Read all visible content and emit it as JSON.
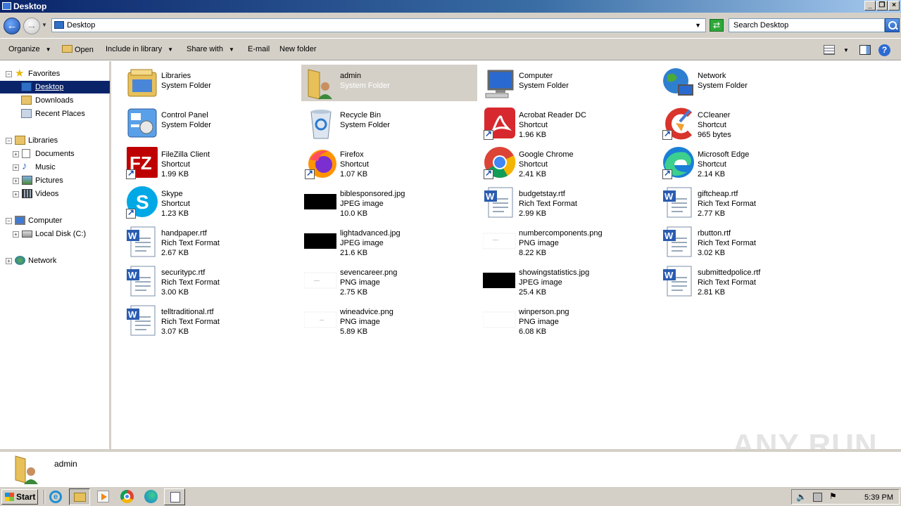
{
  "window": {
    "title": "Desktop"
  },
  "address": {
    "path": "Desktop",
    "search_placeholder": "Search Desktop"
  },
  "toolbar": {
    "organize": "Organize",
    "open": "Open",
    "include": "Include in library",
    "share": "Share with",
    "email": "E-mail",
    "new_folder": "New folder"
  },
  "nav": {
    "favorites": "Favorites",
    "desktop": "Desktop",
    "downloads": "Downloads",
    "recent": "Recent Places",
    "libraries": "Libraries",
    "documents": "Documents",
    "music": "Music",
    "pictures": "Pictures",
    "videos": "Videos",
    "computer": "Computer",
    "localdisk": "Local Disk (C:)",
    "network": "Network"
  },
  "items": [
    {
      "name": "Libraries",
      "type": "System Folder",
      "size": "",
      "icon": "libraries-icon"
    },
    {
      "name": "admin",
      "type": "System Folder",
      "size": "",
      "icon": "user-folder-icon"
    },
    {
      "name": "Computer",
      "type": "System Folder",
      "size": "",
      "icon": "computer-icon"
    },
    {
      "name": "Network",
      "type": "System Folder",
      "size": "",
      "icon": "network-icon"
    },
    {
      "name": "Control Panel",
      "type": "System Folder",
      "size": "",
      "icon": "control-panel-icon"
    },
    {
      "name": "Recycle Bin",
      "type": "System Folder",
      "size": "",
      "icon": "recycle-bin-icon"
    },
    {
      "name": "Acrobat Reader DC",
      "type": "Shortcut",
      "size": "1.96 KB",
      "icon": "acrobat-icon"
    },
    {
      "name": "CCleaner",
      "type": "Shortcut",
      "size": "965 bytes",
      "icon": "ccleaner-icon"
    },
    {
      "name": "FileZilla Client",
      "type": "Shortcut",
      "size": "1.99 KB",
      "icon": "filezilla-icon"
    },
    {
      "name": "Firefox",
      "type": "Shortcut",
      "size": "1.07 KB",
      "icon": "firefox-icon"
    },
    {
      "name": "Google Chrome",
      "type": "Shortcut",
      "size": "2.41 KB",
      "icon": "chrome-icon"
    },
    {
      "name": "Microsoft Edge",
      "type": "Shortcut",
      "size": "2.14 KB",
      "icon": "edge-icon"
    },
    {
      "name": "Skype",
      "type": "Shortcut",
      "size": "1.23 KB",
      "icon": "skype-icon"
    },
    {
      "name": "biblesponsored.jpg",
      "type": "JPEG image",
      "size": "10.0 KB",
      "icon": "jpeg-thumbnail-icon"
    },
    {
      "name": "budgetstay.rtf",
      "type": "Rich Text Format",
      "size": "2.99 KB",
      "icon": "rtf-icon"
    },
    {
      "name": "giftcheap.rtf",
      "type": "Rich Text Format",
      "size": "2.77 KB",
      "icon": "rtf-icon"
    },
    {
      "name": "handpaper.rtf",
      "type": "Rich Text Format",
      "size": "2.67 KB",
      "icon": "rtf-icon"
    },
    {
      "name": "lightadvanced.jpg",
      "type": "JPEG image",
      "size": "21.6 KB",
      "icon": "jpeg-thumbnail-icon"
    },
    {
      "name": "numbercomponents.png",
      "type": "PNG image",
      "size": "8.22 KB",
      "icon": "png-thumbnail-icon"
    },
    {
      "name": "rbutton.rtf",
      "type": "Rich Text Format",
      "size": "3.02 KB",
      "icon": "rtf-icon"
    },
    {
      "name": "securitypc.rtf",
      "type": "Rich Text Format",
      "size": "3.00 KB",
      "icon": "rtf-icon"
    },
    {
      "name": "sevencareer.png",
      "type": "PNG image",
      "size": "2.75 KB",
      "icon": "png-thumbnail-icon"
    },
    {
      "name": "showingstatistics.jpg",
      "type": "JPEG image",
      "size": "25.4 KB",
      "icon": "jpeg-thumbnail-icon"
    },
    {
      "name": "submittedpolice.rtf",
      "type": "Rich Text Format",
      "size": "2.81 KB",
      "icon": "rtf-icon"
    },
    {
      "name": "telltraditional.rtf",
      "type": "Rich Text Format",
      "size": "3.07 KB",
      "icon": "rtf-icon"
    },
    {
      "name": "wineadvice.png",
      "type": "PNG image",
      "size": "5.89 KB",
      "icon": "png-thumbnail-icon"
    },
    {
      "name": "winperson.png",
      "type": "PNG image",
      "size": "6.08 KB",
      "icon": "png-thumbnail-icon"
    }
  ],
  "details": {
    "name": "admin"
  },
  "watermark": "ANY RUN",
  "taskbar": {
    "start": "Start",
    "clock": "5:39 PM"
  },
  "colors": {
    "selection": "#0a246a",
    "chrome": "#d4d0c8"
  }
}
